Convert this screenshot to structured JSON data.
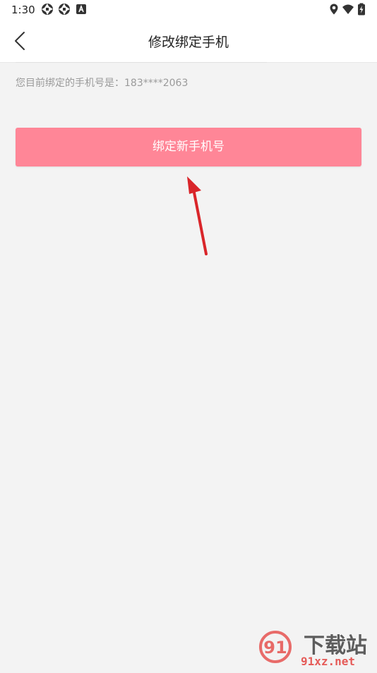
{
  "status_bar": {
    "time": "1:30",
    "left_icons": [
      "aperture-icon",
      "aperture-icon",
      "a-box-icon"
    ],
    "right_icons": [
      "location-icon",
      "wifi-icon",
      "battery-charging-icon"
    ]
  },
  "header": {
    "back_icon": "chevron-left-icon",
    "title": "修改绑定手机"
  },
  "main": {
    "current_phone_text": "您目前绑定的手机号是：183****2063",
    "bind_button_label": "绑定新手机号",
    "annotation": "red-arrow-pointing-to-button"
  },
  "watermark": {
    "logo_text": "91",
    "brand_text": "下载站",
    "url_text": "91xz.net"
  },
  "colors": {
    "button": "#ff8697",
    "background": "#f3f3f3",
    "arrow": "#d9252a",
    "watermark_red": "#e2312d"
  }
}
